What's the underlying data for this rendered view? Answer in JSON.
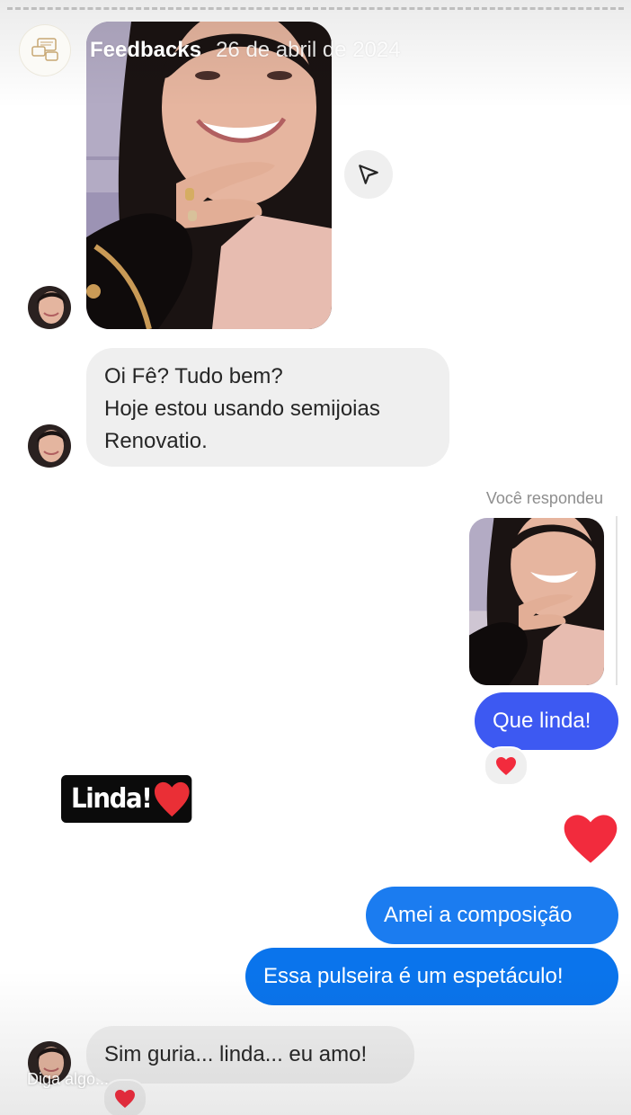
{
  "story": {
    "account_name": "Feedbacks",
    "date": "26 de abril de 2024",
    "reply_placeholder": "Diga algo..."
  },
  "icons": {
    "account_avatar": "chat-bubbles-logo-icon",
    "share": "paper-plane-icon",
    "reaction": "red-heart-icon",
    "big_reaction": "red-heart-icon"
  },
  "colors": {
    "incoming_bubble": "#efefef",
    "outgoing_bubble_purple": "#3d59f2",
    "outgoing_bubble_blue": "#1b7cf0",
    "heart": "#f22b3d",
    "sticker_bg": "#0b0b0b"
  },
  "chat": {
    "incoming_message_1": {
      "line_1": "Oi Fê?  Tudo bem?",
      "line_2": "Hoje estou usando semijoias",
      "line_3": "Renovatio."
    },
    "replied_label": "Você respondeu",
    "outgoing_message_1": "Que linda!",
    "sticker_text": "Linda!",
    "outgoing_message_2": "Amei a composição",
    "outgoing_message_3": "Essa pulseira é um espetáculo!",
    "incoming_message_2": "Sim guria... linda... eu amo!"
  }
}
